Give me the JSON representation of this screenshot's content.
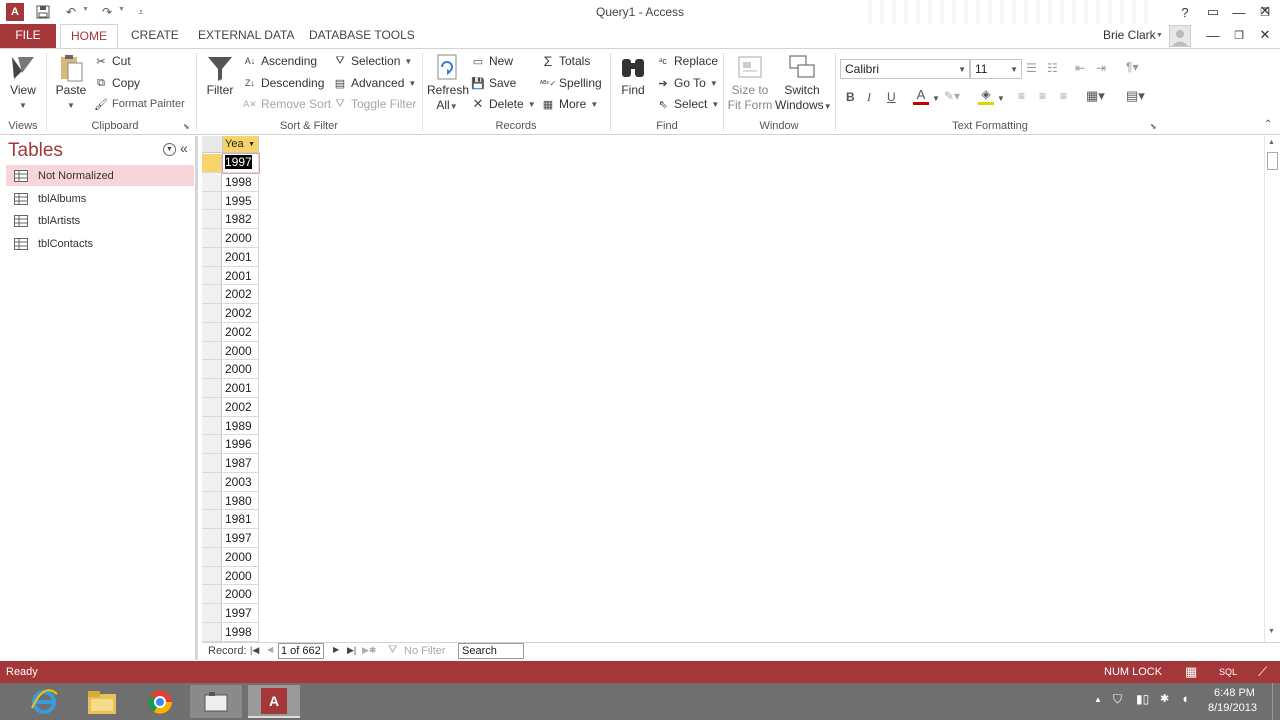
{
  "window": {
    "title": "Query1 - Access",
    "user": "Brie Clark",
    "help": "?"
  },
  "tabs": [
    {
      "label": "FILE"
    },
    {
      "label": "HOME"
    },
    {
      "label": "CREATE"
    },
    {
      "label": "EXTERNAL DATA"
    },
    {
      "label": "DATABASE TOOLS"
    }
  ],
  "ribbon": {
    "views": {
      "view": "View",
      "group": "Views"
    },
    "clipboard": {
      "paste": "Paste",
      "cut": "Cut",
      "copy": "Copy",
      "format_painter": "Format Painter",
      "group": "Clipboard"
    },
    "sort_filter": {
      "filter": "Filter",
      "ascending": "Ascending",
      "descending": "Descending",
      "remove_sort": "Remove Sort",
      "selection": "Selection",
      "advanced": "Advanced",
      "toggle_filter": "Toggle Filter",
      "group": "Sort & Filter"
    },
    "records": {
      "refresh": "Refresh",
      "refresh2": "All",
      "new": "New",
      "save": "Save",
      "delete": "Delete",
      "totals": "Totals",
      "spelling": "Spelling",
      "more": "More",
      "group": "Records"
    },
    "find": {
      "find": "Find",
      "replace": "Replace",
      "goto": "Go To",
      "select": "Select",
      "group": "Find"
    },
    "window": {
      "size": "Size to",
      "size2": "Fit Form",
      "switch": "Switch",
      "switch2": "Windows",
      "group": "Window"
    },
    "text": {
      "font": "Calibri",
      "size": "11",
      "bold": "B",
      "italic": "I",
      "underline": "U",
      "group": "Text Formatting"
    }
  },
  "nav": {
    "title": "Tables",
    "items": [
      {
        "label": "Not Normalized"
      },
      {
        "label": "tblAlbums"
      },
      {
        "label": "tblArtists"
      },
      {
        "label": "tblContacts"
      }
    ]
  },
  "sheet": {
    "header": "Yea",
    "rows": [
      "1997",
      "1998",
      "1995",
      "1982",
      "2000",
      "2001",
      "2001",
      "2002",
      "2002",
      "2002",
      "2000",
      "2000",
      "2001",
      "2002",
      "1989",
      "1996",
      "1987",
      "2003",
      "1980",
      "1981",
      "1997",
      "2000",
      "2000",
      "2000",
      "1997",
      "1998"
    ]
  },
  "recnav": {
    "label": "Record:",
    "current": "1 of 662",
    "filter": "No Filter",
    "search": "Search"
  },
  "status": {
    "left": "Ready",
    "numlock": "NUM LOCK",
    "sql": "SQL"
  },
  "taskbar": {
    "time": "6:48 PM",
    "date": "8/19/2013"
  },
  "colors": {
    "accent": "#a4373a",
    "selected_nav": "#f7d5d8",
    "taskbar": "#6f6f6f"
  }
}
